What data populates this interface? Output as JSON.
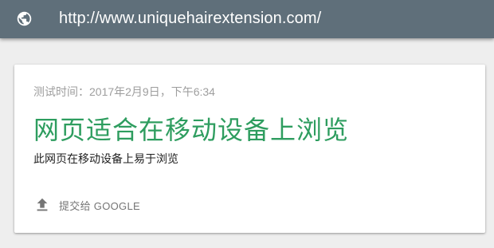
{
  "address_bar": {
    "url": "http://www.uniquehairextension.com/",
    "icon": "globe-icon"
  },
  "result_card": {
    "test_time": "测试时间：2017年2月9日，下午6:34",
    "headline": "网页适合在移动设备上浏览",
    "description": "此网页在移动设备上易于浏览",
    "submit_label": "提交给 GOOGLE",
    "submit_icon": "upload-icon",
    "headline_color": "#2e9d5f"
  },
  "colors": {
    "url_bar": "#5f6f7a",
    "background": "#eeeeee",
    "card": "#ffffff"
  }
}
